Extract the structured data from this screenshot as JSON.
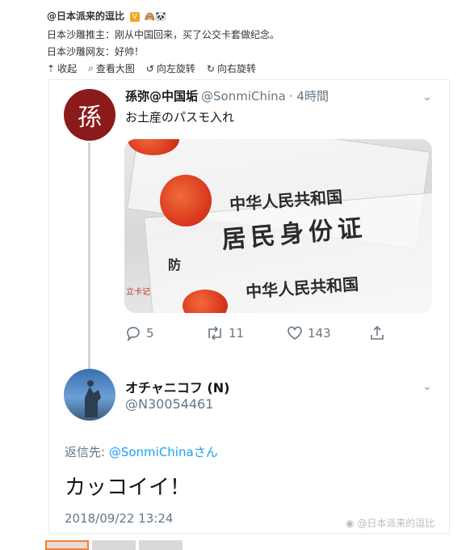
{
  "post": {
    "author": "@日本派来的逗比",
    "line1": "日本沙雕推主：刚从中国回来，买了公交卡套做纪念。",
    "line2": "日本沙雕网友：好帅！"
  },
  "toolbar": {
    "collapse": "收起",
    "view_large": "查看大图",
    "rotate_left": "向左旋转",
    "rotate_right": "向右旋转"
  },
  "tweet": {
    "avatar_char": "孫",
    "name": "孫弥@中国垢",
    "handle": "@SonmiChina",
    "time": "· 4時間",
    "text": "お土産のパスモ入れ",
    "photo_text": {
      "top": "中华人民共和国",
      "mid": "居民身份证",
      "bottom": "中华人民共和国",
      "side": "防",
      "tag": "立卡记"
    },
    "replies": "5",
    "retweets": "11",
    "likes": "143"
  },
  "reply": {
    "name": "オチャニコフ (N)",
    "handle": "@N30054461",
    "reply_to_label": "返信先:",
    "reply_to_user": "@SonmiChina",
    "reply_to_suffix": "さん",
    "text": "カッコイイ！",
    "timestamp": "2018/09/22 13:24"
  },
  "watermark": "@日本派来的逗比",
  "colors": {
    "accent": "#1da1f2",
    "avatar_red": "#8b1a1a",
    "thumb_active": "#f77c3a"
  }
}
